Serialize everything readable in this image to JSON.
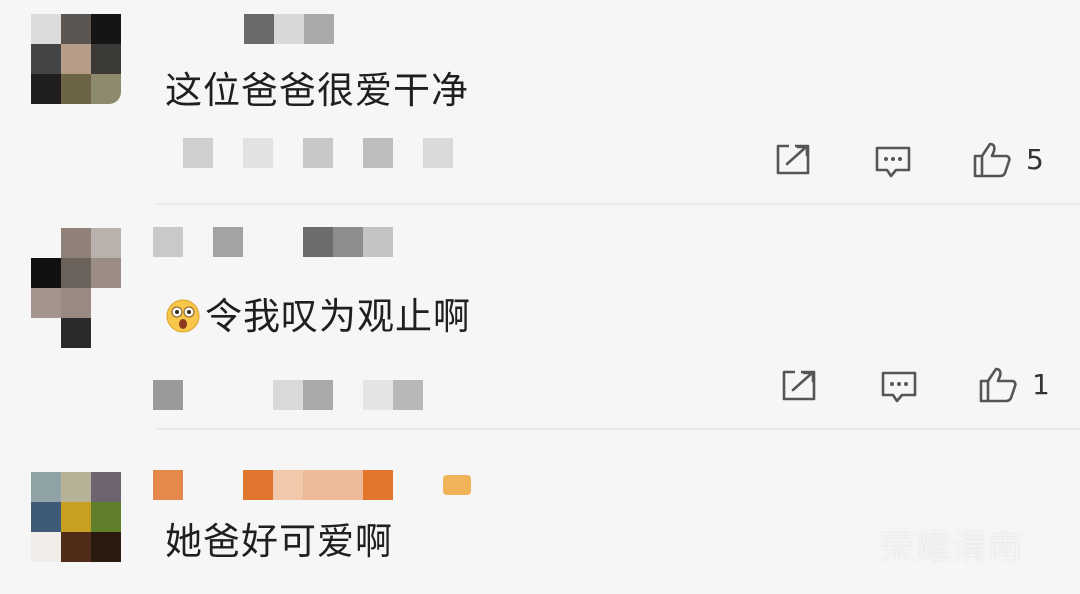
{
  "comments": [
    {
      "text": "这位爸爸很爱干净",
      "like_count": "5",
      "avatar_colors": [
        "#dcdcdc",
        "#5b5651",
        "#151515",
        "#444444",
        "#b59d8a",
        "#3b3a36",
        "#1f1d1d",
        "#6c6445",
        "#8e8a6d"
      ],
      "name_colors": [
        "#6a6a6a",
        "#d8d8d8",
        "#a9a9a9"
      ],
      "meta_colors": [
        "#cfcfcf",
        "#e2e2e2",
        "#c8c8c8",
        "#bdbdbd",
        "#dadada"
      ]
    },
    {
      "text": "令我叹为观止啊",
      "emoji": "astonished-face",
      "like_count": "1",
      "avatar_colors": [
        "#f6f6f6",
        "#8f8078",
        "#b9b1ab",
        "#111111",
        "#6c625c",
        "#9b8d86",
        "#a5948d",
        "#9a8980",
        "#f6f6f6"
      ],
      "name_colors": [
        "#c9c9c9",
        "#a3a3a3",
        "#6d6d6d",
        "#8d8d8d",
        "#c4c4c4"
      ],
      "meta_colors": [
        "#9a9a9a",
        "#d9d9d9",
        "#a9a9a9",
        "#e4e4e4",
        "#b8b8b8"
      ]
    },
    {
      "text": "她爸好可爱啊",
      "avatar_colors": [
        "#8fa2a5",
        "#b6b197",
        "#6d6470",
        "#3f5a76",
        "#c7a021",
        "#5f7f2a",
        "#f0ece8",
        "#4f2b18",
        "#2b1a10"
      ],
      "name_colors": [
        "#e4884c",
        "#f6f6f6",
        "#e0762e",
        "#f1c8a9",
        "#ecb999",
        "#e2762c",
        "#f0b357"
      ],
      "meta_colors": []
    }
  ],
  "watermark": "荣耀渭南"
}
